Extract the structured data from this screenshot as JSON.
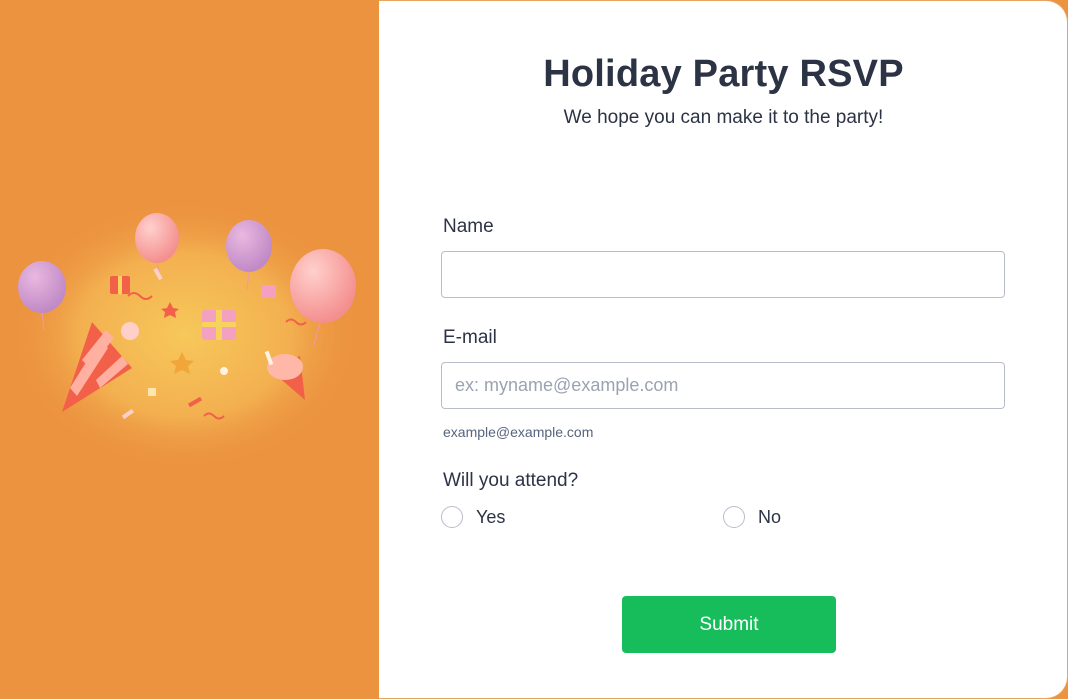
{
  "form": {
    "title": "Holiday Party RSVP",
    "subtitle": "We hope you can make it to the party!",
    "name_label": "Name",
    "name_value": "",
    "email_label": "E-mail",
    "email_placeholder": "ex: myname@example.com",
    "email_hint": "example@example.com",
    "attend_label": "Will you attend?",
    "attend_options": [
      "Yes",
      "No"
    ],
    "submit_label": "Submit"
  },
  "colors": {
    "left_panel": "#ec9340",
    "submit": "#18bd5b",
    "text": "#2c3345"
  }
}
